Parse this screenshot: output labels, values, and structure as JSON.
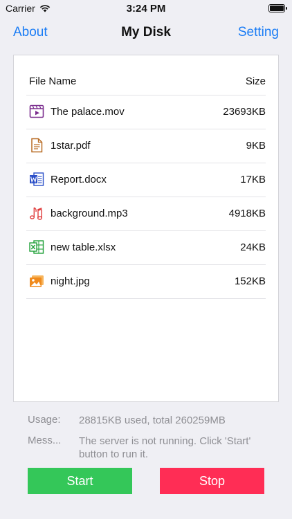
{
  "status": {
    "carrier": "Carrier",
    "time": "3:24 PM"
  },
  "nav": {
    "left": "About",
    "title": "My Disk",
    "right": "Setting"
  },
  "table": {
    "headers": {
      "name": "File Name",
      "size": "Size"
    },
    "rows": [
      {
        "name": "The palace.mov",
        "size": "23693KB",
        "icon": "video-file-icon",
        "color": "#7b2d8e"
      },
      {
        "name": "1star.pdf",
        "size": "9KB",
        "icon": "pdf-file-icon",
        "color": "#b86b23"
      },
      {
        "name": "Report.docx",
        "size": "17KB",
        "icon": "word-file-icon",
        "color": "#2b4fc8"
      },
      {
        "name": "background.mp3",
        "size": "4918KB",
        "icon": "music-file-icon",
        "color": "#e03c3c"
      },
      {
        "name": "new table.xlsx",
        "size": "24KB",
        "icon": "excel-file-icon",
        "color": "#21a13a"
      },
      {
        "name": "night.jpg",
        "size": "152KB",
        "icon": "image-file-icon",
        "color": "#f08a1c"
      }
    ]
  },
  "info": {
    "usage_label": "Usage:",
    "usage_value": "28815KB used, total 260259MB",
    "message_label": "Mess...",
    "message_value": "The server is not running. Click 'Start' button to run it."
  },
  "buttons": {
    "start": "Start",
    "stop": "Stop"
  },
  "colors": {
    "accent": "#1a7cf5",
    "start": "#34c759",
    "stop": "#ff2d55"
  }
}
